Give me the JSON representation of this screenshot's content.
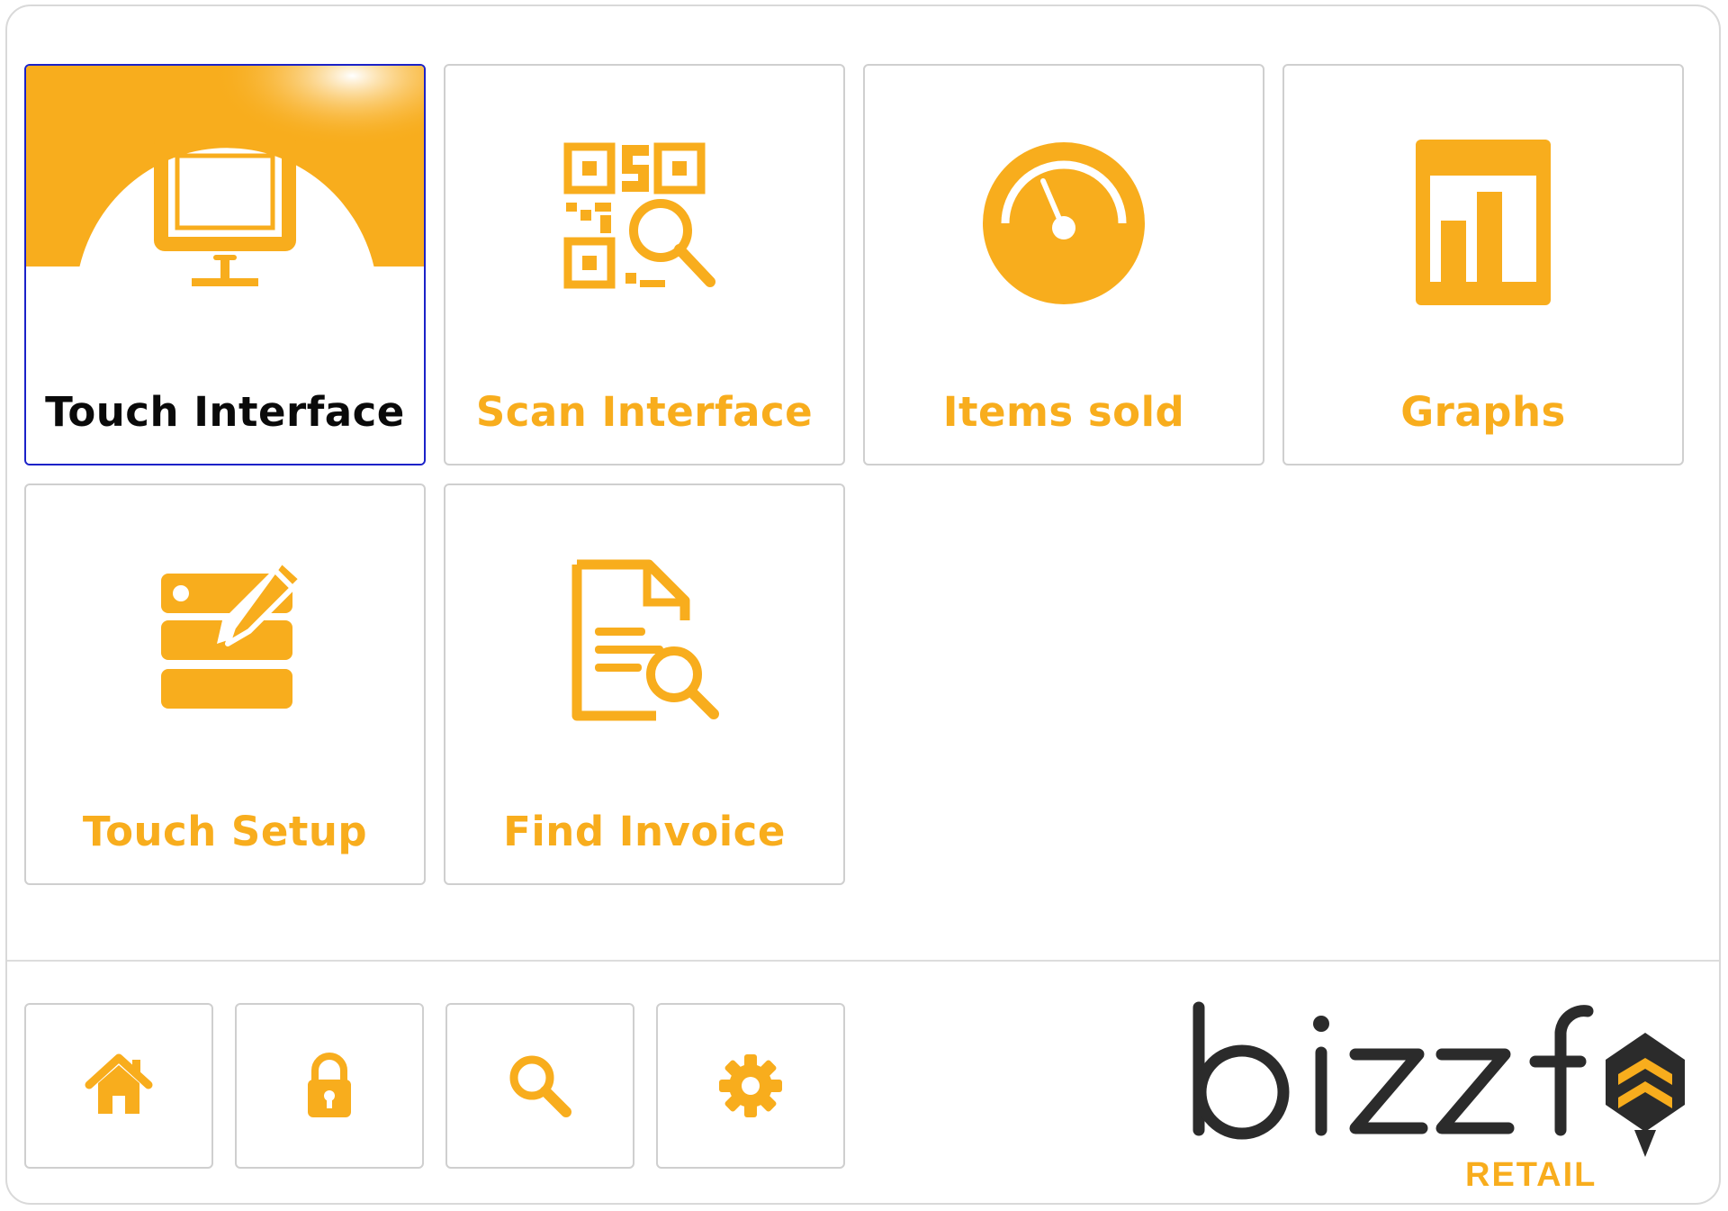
{
  "colors": {
    "accent": "#f8ad1d",
    "selected_border": "#1b22c8",
    "tile_border": "#cfcfcf",
    "logo_dark": "#2b2b2b"
  },
  "tiles": [
    {
      "label": "Touch Interface",
      "icon": "monitor-icon",
      "selected": true
    },
    {
      "label": "Scan Interface",
      "icon": "qr-search-icon",
      "selected": false
    },
    {
      "label": "Items sold",
      "icon": "gauge-icon",
      "selected": false
    },
    {
      "label": "Graphs",
      "icon": "bar-chart-icon",
      "selected": false
    },
    {
      "label": "Touch Setup",
      "icon": "database-edit-icon",
      "selected": false
    },
    {
      "label": "Find Invoice",
      "icon": "document-search-icon",
      "selected": false
    }
  ],
  "toolbar": [
    {
      "icon": "home-icon"
    },
    {
      "icon": "lock-icon"
    },
    {
      "icon": "search-icon"
    },
    {
      "icon": "gear-icon"
    }
  ],
  "brand": {
    "name": "bizzfo",
    "tagline": "RETAIL"
  }
}
